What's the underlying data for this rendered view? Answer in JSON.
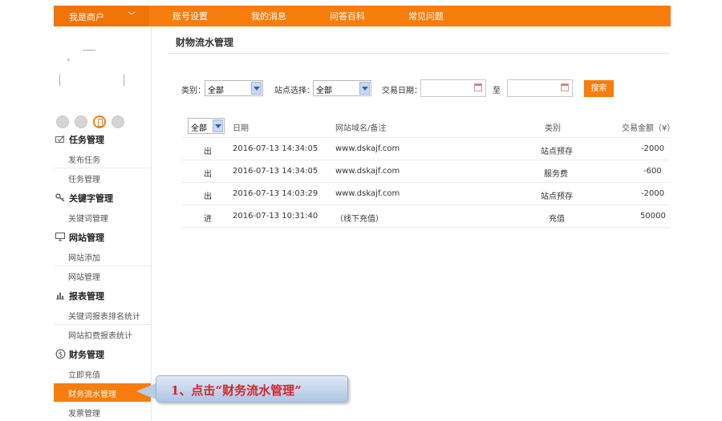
{
  "topbar": {
    "role_label": "我是商户",
    "role_arrow": "﹀",
    "nav": [
      "账号设置",
      "我的消息",
      "问答百科",
      "常见问题"
    ]
  },
  "sidebar": {
    "sections": [
      {
        "label": "任务管理",
        "icon": "task-icon",
        "items": [
          "发布任务",
          "任务管理"
        ]
      },
      {
        "label": "关键字管理",
        "icon": "key-icon",
        "items": [
          "关键词管理"
        ]
      },
      {
        "label": "网站管理",
        "icon": "monitor-icon",
        "items": [
          "网站添加",
          "网站管理"
        ]
      },
      {
        "label": "报表管理",
        "icon": "bar-chart-icon",
        "items": [
          "关键词报表排名统计",
          "网站扣费报表统计"
        ]
      },
      {
        "label": "财务管理",
        "icon": "dollar-icon",
        "items": [
          "立即充值",
          "财务流水管理",
          "发票管理"
        ]
      }
    ],
    "active_item": "财务流水管理"
  },
  "main": {
    "title": "财物流水管理",
    "filters": {
      "category_label": "类别：",
      "category_value": "全部",
      "site_label": "站点选择：",
      "site_value": "全部",
      "date_label": "交易日期：",
      "to_label": "至",
      "search_button": "搜索"
    },
    "table": {
      "direction_filter": "全部",
      "headers": [
        "日期",
        "网站域名/备注",
        "类别",
        "交易金额（¥）"
      ],
      "rows": [
        [
          "出",
          "2016-07-13 14:34:05",
          "www.dskajf.com",
          "站点预存",
          "-2000"
        ],
        [
          "出",
          "2016-07-13 14:34:05",
          "www.dskajf.com",
          "服务费",
          "-600"
        ],
        [
          "出",
          "2016-07-13 14:03:29",
          "www.dskajf.com",
          "站点预存",
          "-2000"
        ],
        [
          "进",
          "2016-07-13 10:31:40",
          "（线下充值）",
          "充值",
          "50000"
        ]
      ]
    }
  },
  "callout": {
    "text": "1、点击“财务流水管理”",
    "color": "#d0272b"
  },
  "colors": {
    "accent": "#f77d0c"
  }
}
